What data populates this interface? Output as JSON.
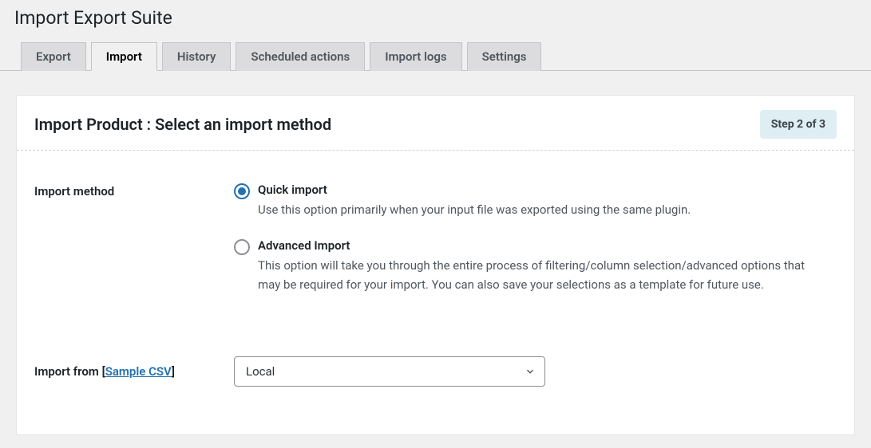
{
  "page": {
    "title": "Import Export Suite"
  },
  "tabs": [
    {
      "label": "Export"
    },
    {
      "label": "Import"
    },
    {
      "label": "History"
    },
    {
      "label": "Scheduled actions"
    },
    {
      "label": "Import logs"
    },
    {
      "label": "Settings"
    }
  ],
  "panel": {
    "title": "Import Product : Select an import method",
    "step_label": "Step 2 of 3"
  },
  "form": {
    "method_label": "Import method",
    "options": {
      "quick": {
        "title": "Quick import",
        "desc": "Use this option primarily when your input file was exported using the same plugin."
      },
      "advanced": {
        "title": "Advanced Import",
        "desc": "This option will take you through the entire process of filtering/column selection/advanced options that may be required for your import. You can also save your selections as a template for future use."
      }
    },
    "import_from": {
      "label_prefix": "Import from ",
      "sample_link": "Sample CSV",
      "selected_value": "Local"
    }
  }
}
